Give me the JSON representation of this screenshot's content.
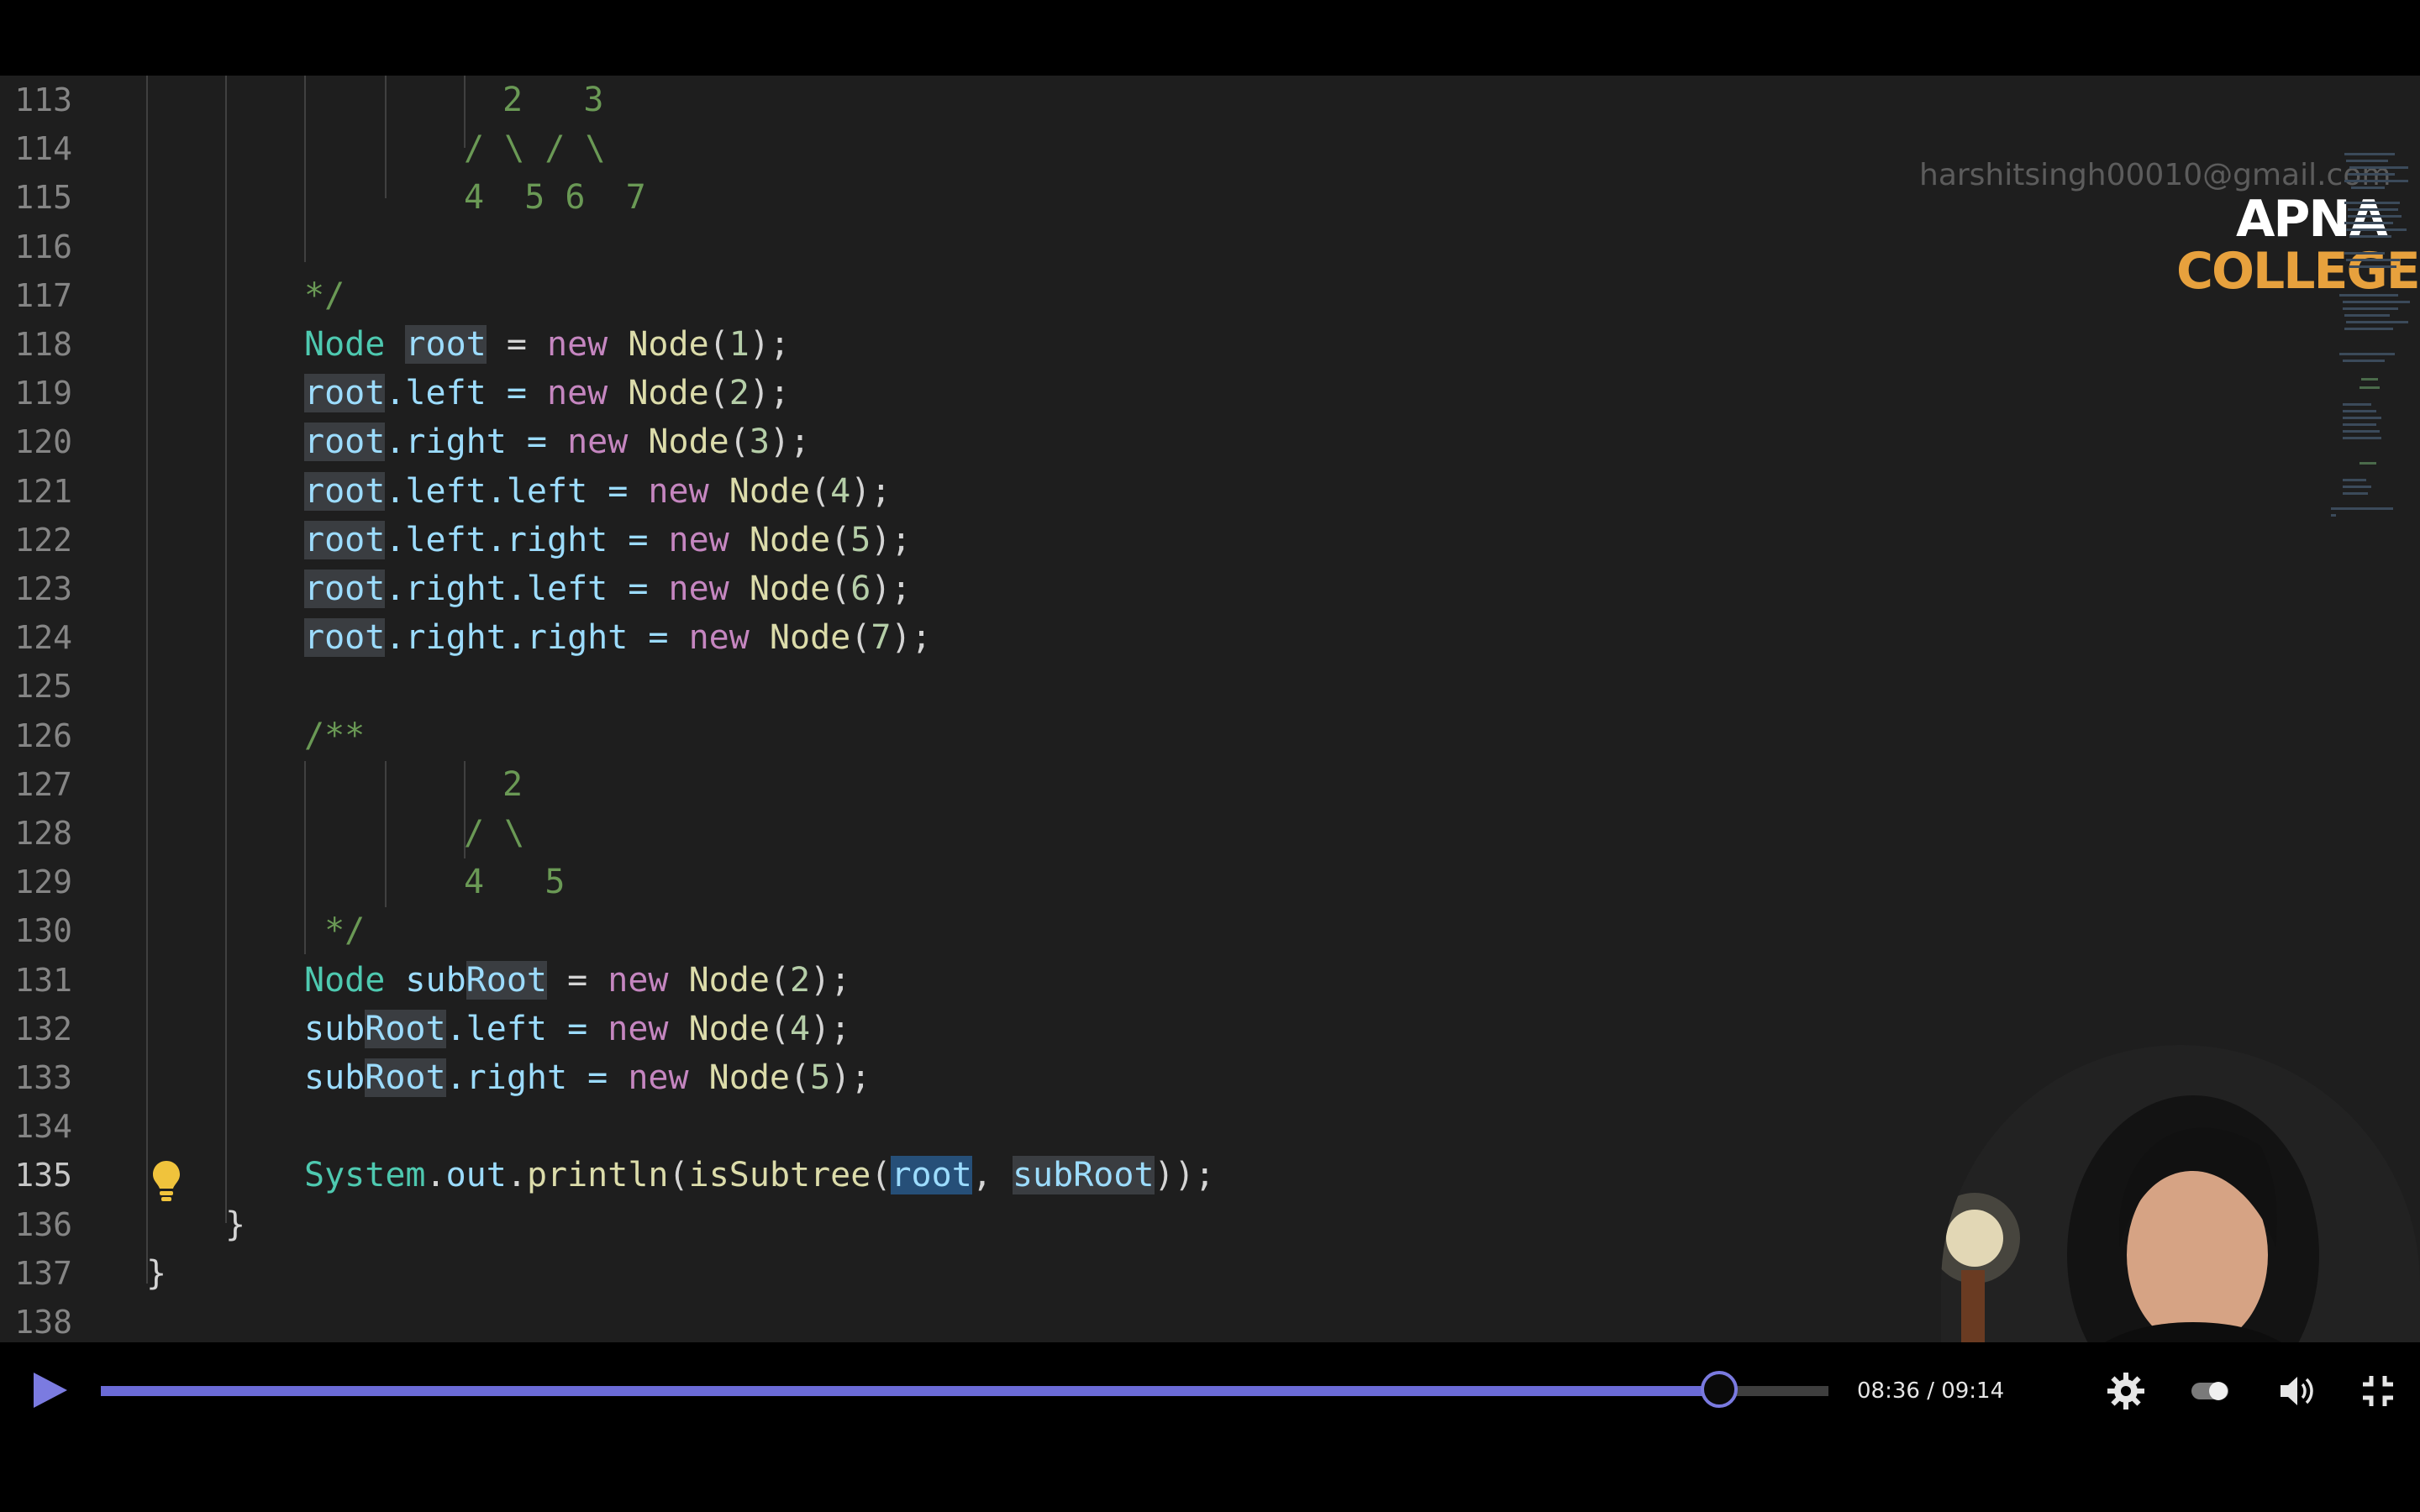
{
  "watermark": {
    "email": "harshitsingh00010@gmail.com",
    "logo_line1": "APNA",
    "logo_line2": "COLLEGE"
  },
  "editor": {
    "lines": [
      {
        "num": "113",
        "tokens": [
          {
            "t": "2   3",
            "c": "cm"
          }
        ]
      },
      {
        "num": "114",
        "tokens": [
          {
            "t": "/ \\ / \\",
            "c": "cm"
          }
        ]
      },
      {
        "num": "115",
        "tokens": [
          {
            "t": "4  5 6  7",
            "c": "cm"
          }
        ]
      },
      {
        "num": "116",
        "tokens": []
      },
      {
        "num": "117",
        "tokens": [
          {
            "t": "*/",
            "c": "cm"
          }
        ]
      },
      {
        "num": "118",
        "tokens": [
          {
            "t": "Node",
            "c": "ty"
          },
          {
            "t": " ",
            "c": ""
          },
          {
            "t": "root",
            "c": "var hl"
          },
          {
            "t": " = ",
            "c": ""
          },
          {
            "t": "new",
            "c": "kw"
          },
          {
            "t": " ",
            "c": ""
          },
          {
            "t": "Node",
            "c": "fn"
          },
          {
            "t": "(",
            "c": ""
          },
          {
            "t": "1",
            "c": "num"
          },
          {
            "t": ");",
            "c": ""
          }
        ]
      },
      {
        "num": "119",
        "tokens": [
          {
            "t": "root",
            "c": "var hl"
          },
          {
            "t": ".left = ",
            "c": "var"
          },
          {
            "t": "new",
            "c": "kw"
          },
          {
            "t": " ",
            "c": ""
          },
          {
            "t": "Node",
            "c": "fn"
          },
          {
            "t": "(",
            "c": ""
          },
          {
            "t": "2",
            "c": "num"
          },
          {
            "t": ");",
            "c": ""
          }
        ]
      },
      {
        "num": "120",
        "tokens": [
          {
            "t": "root",
            "c": "var hl"
          },
          {
            "t": ".right = ",
            "c": "var"
          },
          {
            "t": "new",
            "c": "kw"
          },
          {
            "t": " ",
            "c": ""
          },
          {
            "t": "Node",
            "c": "fn"
          },
          {
            "t": "(",
            "c": ""
          },
          {
            "t": "3",
            "c": "num"
          },
          {
            "t": ");",
            "c": ""
          }
        ]
      },
      {
        "num": "121",
        "tokens": [
          {
            "t": "root",
            "c": "var hl"
          },
          {
            "t": ".left.left = ",
            "c": "var"
          },
          {
            "t": "new",
            "c": "kw"
          },
          {
            "t": " ",
            "c": ""
          },
          {
            "t": "Node",
            "c": "fn"
          },
          {
            "t": "(",
            "c": ""
          },
          {
            "t": "4",
            "c": "num"
          },
          {
            "t": ");",
            "c": ""
          }
        ]
      },
      {
        "num": "122",
        "tokens": [
          {
            "t": "root",
            "c": "var hl"
          },
          {
            "t": ".left.right = ",
            "c": "var"
          },
          {
            "t": "new",
            "c": "kw"
          },
          {
            "t": " ",
            "c": ""
          },
          {
            "t": "Node",
            "c": "fn"
          },
          {
            "t": "(",
            "c": ""
          },
          {
            "t": "5",
            "c": "num"
          },
          {
            "t": ");",
            "c": ""
          }
        ]
      },
      {
        "num": "123",
        "tokens": [
          {
            "t": "root",
            "c": "var hl"
          },
          {
            "t": ".right.left = ",
            "c": "var"
          },
          {
            "t": "new",
            "c": "kw"
          },
          {
            "t": " ",
            "c": ""
          },
          {
            "t": "Node",
            "c": "fn"
          },
          {
            "t": "(",
            "c": ""
          },
          {
            "t": "6",
            "c": "num"
          },
          {
            "t": ");",
            "c": ""
          }
        ]
      },
      {
        "num": "124",
        "tokens": [
          {
            "t": "root",
            "c": "var hl"
          },
          {
            "t": ".right.right = ",
            "c": "var"
          },
          {
            "t": "new",
            "c": "kw"
          },
          {
            "t": " ",
            "c": ""
          },
          {
            "t": "Node",
            "c": "fn"
          },
          {
            "t": "(",
            "c": ""
          },
          {
            "t": "7",
            "c": "num"
          },
          {
            "t": ");",
            "c": ""
          }
        ]
      },
      {
        "num": "125",
        "tokens": []
      },
      {
        "num": "126",
        "tokens": [
          {
            "t": "/**",
            "c": "cm"
          }
        ]
      },
      {
        "num": "127",
        "tokens": [
          {
            "t": "2",
            "c": "cm"
          }
        ]
      },
      {
        "num": "128",
        "tokens": [
          {
            "t": "/ \\",
            "c": "cm"
          }
        ]
      },
      {
        "num": "129",
        "tokens": [
          {
            "t": "4   5",
            "c": "cm"
          }
        ]
      },
      {
        "num": "130",
        "tokens": [
          {
            "t": " */",
            "c": "cm"
          }
        ]
      },
      {
        "num": "131",
        "tokens": [
          {
            "t": "Node",
            "c": "ty"
          },
          {
            "t": " ",
            "c": ""
          },
          {
            "t": "sub",
            "c": "var"
          },
          {
            "t": "Root",
            "c": "var hl"
          },
          {
            "t": " = ",
            "c": ""
          },
          {
            "t": "new",
            "c": "kw"
          },
          {
            "t": " ",
            "c": ""
          },
          {
            "t": "Node",
            "c": "fn"
          },
          {
            "t": "(",
            "c": ""
          },
          {
            "t": "2",
            "c": "num"
          },
          {
            "t": ");",
            "c": ""
          }
        ]
      },
      {
        "num": "132",
        "tokens": [
          {
            "t": "sub",
            "c": "var"
          },
          {
            "t": "Root",
            "c": "var hl"
          },
          {
            "t": ".left = ",
            "c": "var"
          },
          {
            "t": "new",
            "c": "kw"
          },
          {
            "t": " ",
            "c": ""
          },
          {
            "t": "Node",
            "c": "fn"
          },
          {
            "t": "(",
            "c": ""
          },
          {
            "t": "4",
            "c": "num"
          },
          {
            "t": ");",
            "c": ""
          }
        ]
      },
      {
        "num": "133",
        "tokens": [
          {
            "t": "sub",
            "c": "var"
          },
          {
            "t": "Root",
            "c": "var hl"
          },
          {
            "t": ".right = ",
            "c": "var"
          },
          {
            "t": "new",
            "c": "kw"
          },
          {
            "t": " ",
            "c": ""
          },
          {
            "t": "Node",
            "c": "fn"
          },
          {
            "t": "(",
            "c": ""
          },
          {
            "t": "5",
            "c": "num"
          },
          {
            "t": ");",
            "c": ""
          }
        ]
      },
      {
        "num": "134",
        "tokens": []
      },
      {
        "num": "135",
        "tokens": [
          {
            "t": "System",
            "c": "ty"
          },
          {
            "t": ".",
            "c": ""
          },
          {
            "t": "out",
            "c": "var"
          },
          {
            "t": ".",
            "c": ""
          },
          {
            "t": "println",
            "c": "fn"
          },
          {
            "t": "(",
            "c": ""
          },
          {
            "t": "isSubtree",
            "c": "fn"
          },
          {
            "t": "(",
            "c": ""
          },
          {
            "t": "root",
            "c": "var hl-strong"
          },
          {
            "t": ", ",
            "c": ""
          },
          {
            "t": "subRoot",
            "c": "var hl"
          },
          {
            "t": "));",
            "c": ""
          }
        ]
      },
      {
        "num": "136",
        "tokens": [
          {
            "t": "}",
            "c": ""
          }
        ]
      },
      {
        "num": "137",
        "tokens": [
          {
            "t": "}",
            "c": ""
          }
        ]
      },
      {
        "num": "138",
        "tokens": []
      }
    ],
    "active_line": "135"
  },
  "player": {
    "time": "08:36 / 09:14",
    "progress_fraction": 0.9366,
    "accent_color": "#6b6bd6",
    "icons": [
      "play-icon",
      "gear-icon",
      "toggle-icon",
      "volume-icon",
      "exit-fullscreen-icon"
    ]
  }
}
